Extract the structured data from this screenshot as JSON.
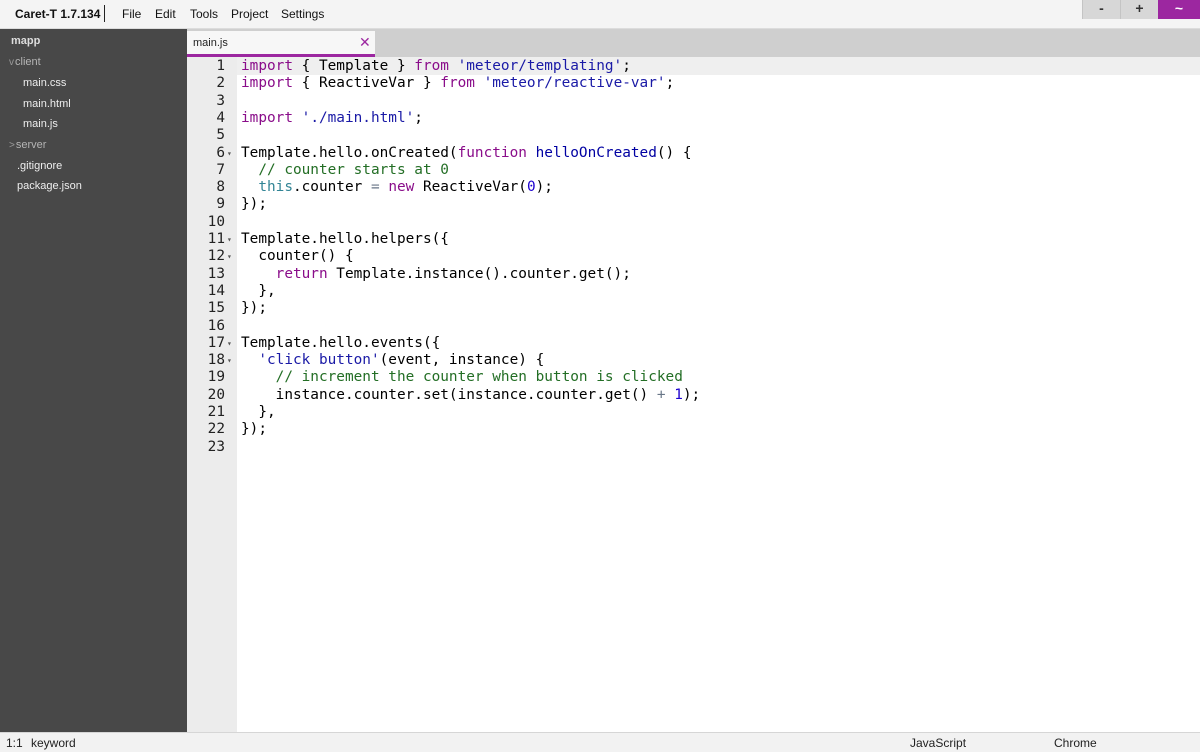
{
  "app": {
    "title": "Caret-T 1.7.134",
    "menu": [
      "File",
      "Edit",
      "Tools",
      "Project",
      "Settings"
    ],
    "window_buttons": {
      "minimize": "-",
      "maximize": "+",
      "menu": "~"
    },
    "accent_color": "#9c27a0"
  },
  "sidebar": {
    "project": "mapp",
    "items": [
      {
        "label": "client",
        "type": "folder",
        "expanded": true,
        "arrow": "v"
      },
      {
        "label": "main.css",
        "type": "file"
      },
      {
        "label": "main.html",
        "type": "file"
      },
      {
        "label": "main.js",
        "type": "file"
      },
      {
        "label": "server",
        "type": "folder",
        "expanded": false,
        "arrow": ">"
      },
      {
        "label": ".gitignore",
        "type": "file"
      },
      {
        "label": "package.json",
        "type": "file"
      }
    ]
  },
  "tabs": [
    {
      "label": "main.js",
      "close_glyph": "✕",
      "active": true
    }
  ],
  "editor": {
    "language": "JavaScript",
    "folding_marker": "▾",
    "fold_lines": [
      6,
      11,
      12,
      17,
      18
    ],
    "lines": [
      "import { Template } from 'meteor/templating';",
      "import { ReactiveVar } from 'meteor/reactive-var';",
      "",
      "import './main.html';",
      "",
      "Template.hello.onCreated(function helloOnCreated() {",
      "  // counter starts at 0",
      "  this.counter = new ReactiveVar(0);",
      "});",
      "",
      "Template.hello.helpers({",
      "  counter() {",
      "    return Template.instance().counter.get();",
      "  },",
      "});",
      "",
      "Template.hello.events({",
      "  'click button'(event, instance) {",
      "    // increment the counter when button is clicked",
      "    instance.counter.set(instance.counter.get() + 1);",
      "  },",
      "});",
      ""
    ]
  },
  "status": {
    "position": "1:1",
    "token": "keyword",
    "mode": "JavaScript",
    "theme": "Chrome"
  }
}
